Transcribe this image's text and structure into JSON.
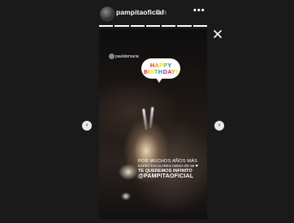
{
  "header": {
    "username": "pampitaoficial",
    "time": "5 h",
    "more": "•••"
  },
  "progress": {
    "segments": 7,
    "current": 7
  },
  "story": {
    "tagged_user": "paulidemaria",
    "sticker": {
      "line1": "HAPPY",
      "line2": "BIRTHDAY!"
    },
    "caption": {
      "line1": "POR MUCHOS AÑOS MÁS",
      "line2": "ESPECTACULARES AMIGA DE MI ❤",
      "line3": "TE QUEREMOS INFINITO",
      "line4": "@PAMPITAOFICIAL"
    }
  },
  "nav": {
    "prev": "‹",
    "next": "›"
  },
  "colors": {
    "background": "#1a1a1a",
    "text": "#ffffff",
    "sticker_colors": [
      "#e94b5a",
      "#f5a623",
      "#f8e71c",
      "#7ed321",
      "#4a90e2",
      "#9b59b6"
    ]
  },
  "icons": {
    "close": "close-icon",
    "prev": "chevron-left-icon",
    "next": "chevron-right-icon",
    "more": "more-icon"
  }
}
